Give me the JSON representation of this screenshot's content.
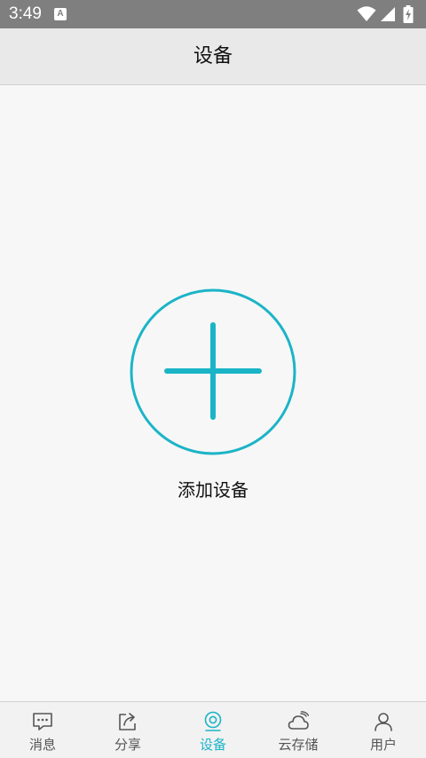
{
  "status_bar": {
    "time": "3:49",
    "notification_icon": "a-icon",
    "notification_letter": "A",
    "icons": [
      "wifi-icon",
      "signal-icon",
      "battery-charging-icon"
    ]
  },
  "header": {
    "title": "设备"
  },
  "main": {
    "add_device_label": "添加设备",
    "add_icon": "plus-circle-icon"
  },
  "tabs": [
    {
      "label": "消息",
      "icon": "message-icon",
      "active": false
    },
    {
      "label": "分享",
      "icon": "share-icon",
      "active": false
    },
    {
      "label": "设备",
      "icon": "camera-icon",
      "active": true
    },
    {
      "label": "云存储",
      "icon": "cloud-icon",
      "active": false
    },
    {
      "label": "用户",
      "icon": "user-icon",
      "active": false
    }
  ],
  "colors": {
    "accent": "#1bb4c7",
    "status_bar": "#7f7f7f",
    "header_bg": "#e9e9e9",
    "page_bg": "#f7f7f7",
    "tab_inactive": "#555555"
  }
}
